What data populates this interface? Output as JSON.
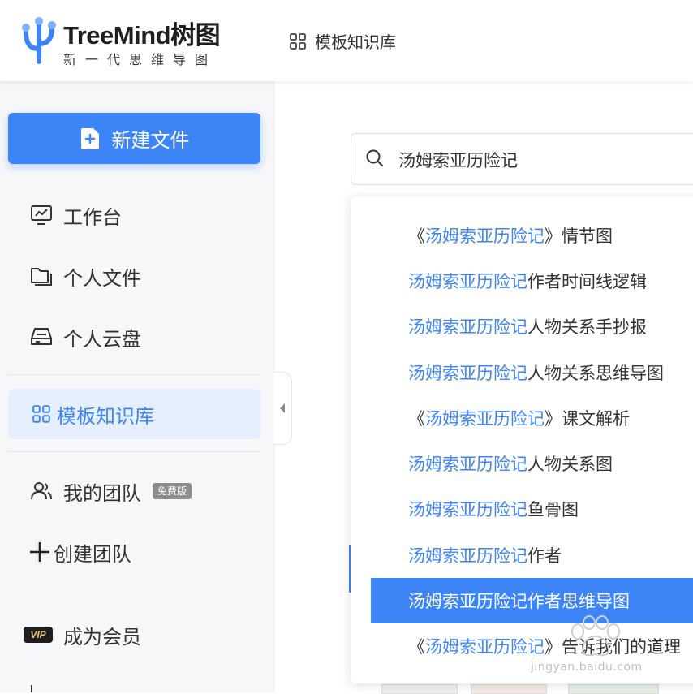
{
  "header": {
    "brand_name": "TreeMind树图",
    "tagline": "新一代思维导图",
    "nav_label": "模板知识库"
  },
  "sidebar": {
    "new_file_label": "新建文件",
    "items": [
      {
        "label": "工作台",
        "icon": "monitor-icon"
      },
      {
        "label": "个人文件",
        "icon": "folder-icon"
      },
      {
        "label": "个人云盘",
        "icon": "cloud-drive-icon"
      },
      {
        "label": "模板知识库",
        "icon": "grid-icon",
        "active": true
      },
      {
        "label": "我的团队",
        "icon": "team-icon",
        "badge": "免费版"
      },
      {
        "label": "创建团队",
        "icon": "plus-icon"
      },
      {
        "label": "成为会员",
        "icon": "vip-icon",
        "badge": "VIP"
      }
    ]
  },
  "search": {
    "value": "汤姆索亚历险记",
    "placeholder": ""
  },
  "suggestions": [
    {
      "prefix": "《",
      "highlight": "汤姆索亚历险记",
      "suffix": "》情节图"
    },
    {
      "prefix": "",
      "highlight": "汤姆索亚历险记",
      "suffix": "作者时间线逻辑"
    },
    {
      "prefix": "",
      "highlight": "汤姆索亚历险记",
      "suffix": "人物关系手抄报"
    },
    {
      "prefix": "",
      "highlight": "汤姆索亚历险记",
      "suffix": "人物关系思维导图"
    },
    {
      "prefix": "《",
      "highlight": "汤姆索亚历险记",
      "suffix": "》课文解析"
    },
    {
      "prefix": "",
      "highlight": "汤姆索亚历险记",
      "suffix": "人物关系图"
    },
    {
      "prefix": "",
      "highlight": "汤姆索亚历险记",
      "suffix": "鱼骨图"
    },
    {
      "prefix": "",
      "highlight": "汤姆索亚历险记",
      "suffix": "作者"
    },
    {
      "prefix": "",
      "highlight": "汤姆索亚历险记",
      "suffix": "作者思维导图",
      "active": true
    },
    {
      "prefix": "《",
      "highlight": "汤姆索亚历险记",
      "suffix": "》告诉我们的道理"
    }
  ],
  "watermark": "jingyan.baidu.com",
  "colors": {
    "accent": "#3d85f7",
    "sidebar_bg": "#f6f7f9",
    "active_bg": "#e6effd"
  }
}
